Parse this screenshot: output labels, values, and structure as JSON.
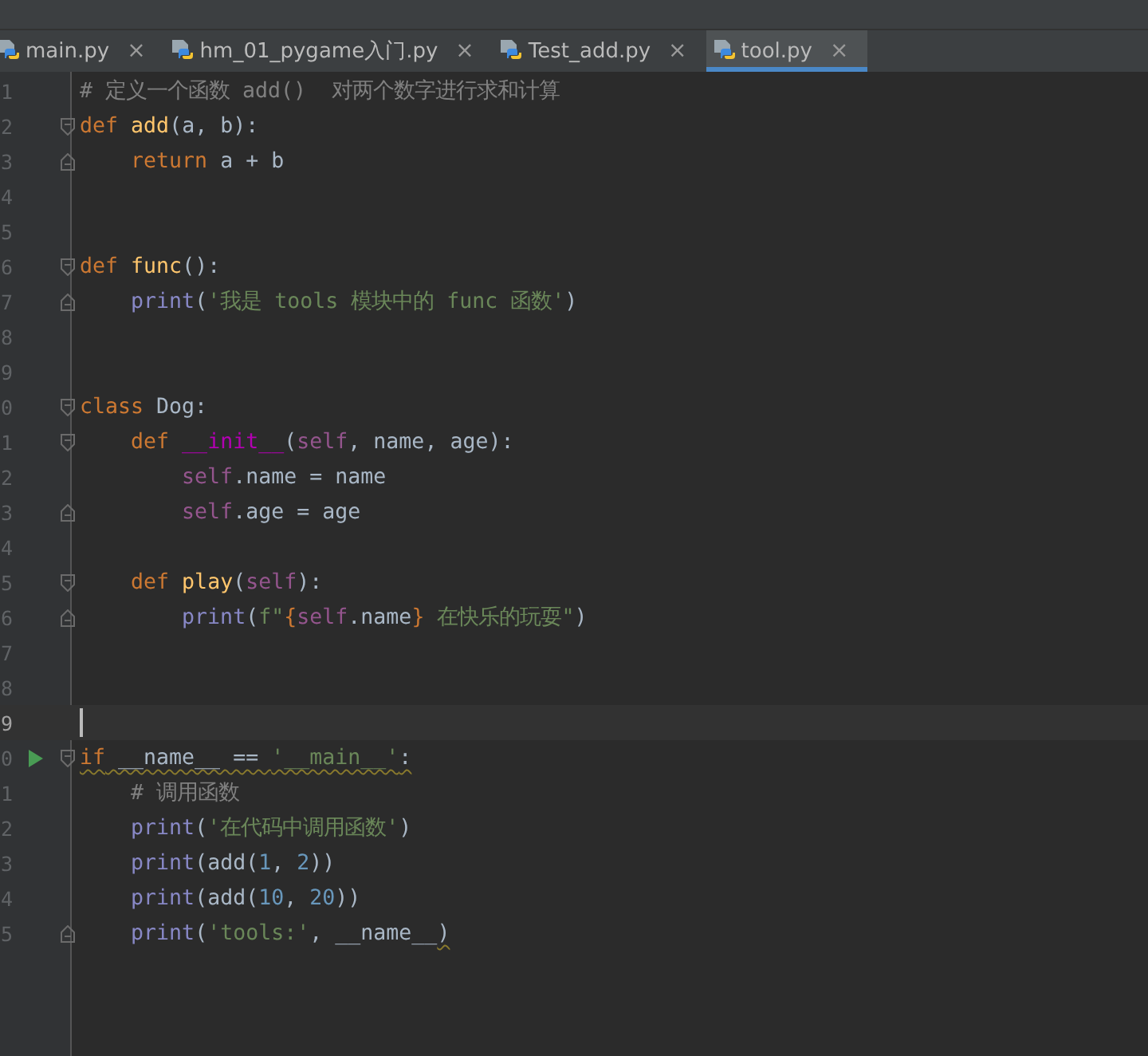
{
  "tabs": [
    {
      "label": "main.py",
      "selected": false,
      "close": "×"
    },
    {
      "label": "hm_01_pygame入门.py",
      "selected": false,
      "close": "×"
    },
    {
      "label": "Test_add.py",
      "selected": false,
      "close": "×"
    },
    {
      "label": "tool.py",
      "selected": true,
      "close": "×"
    }
  ],
  "editor": {
    "lines": [
      {
        "number": "1",
        "fold_start": false,
        "fold_end": false,
        "run": false,
        "current": false,
        "tokens": [
          {
            "kind": "comment",
            "text": "# 定义一个函数 add()  对两个数字进行求和计算"
          }
        ]
      },
      {
        "number": "2",
        "fold_start": true,
        "fold_end": false,
        "run": false,
        "current": false,
        "tokens": [
          {
            "kind": "keyword",
            "text": "def"
          },
          {
            "kind": "function",
            "text": " add"
          },
          {
            "kind": "plain",
            "text": "(a, b):"
          }
        ]
      },
      {
        "number": "3",
        "fold_start": false,
        "fold_end": true,
        "run": false,
        "current": false,
        "tokens": [
          {
            "kind": "keyword",
            "text": "    return"
          },
          {
            "kind": "plain",
            "text": " a + b"
          }
        ]
      },
      {
        "number": "4",
        "fold_start": false,
        "fold_end": false,
        "run": false,
        "current": false
      },
      {
        "number": "5",
        "fold_start": false,
        "fold_end": false,
        "run": false,
        "current": false
      },
      {
        "number": "6",
        "fold_start": true,
        "fold_end": false,
        "run": false,
        "current": false,
        "tokens": [
          {
            "kind": "keyword",
            "text": "def"
          },
          {
            "kind": "function",
            "text": " func"
          },
          {
            "kind": "plain",
            "text": "():"
          }
        ]
      },
      {
        "number": "7",
        "fold_start": false,
        "fold_end": true,
        "run": false,
        "current": false,
        "tokens": [
          {
            "kind": "builtin",
            "text": "    print"
          },
          {
            "kind": "plain",
            "text": "("
          },
          {
            "kind": "string",
            "text": "'我是 tools 模块中的 func 函数'"
          },
          {
            "kind": "plain",
            "text": ")"
          }
        ]
      },
      {
        "number": "8",
        "fold_start": false,
        "fold_end": false,
        "run": false,
        "current": false
      },
      {
        "number": "9",
        "fold_start": false,
        "fold_end": false,
        "run": false,
        "current": false
      },
      {
        "number": "0",
        "fold_start": true,
        "fold_end": false,
        "run": false,
        "current": false,
        "tokens": [
          {
            "kind": "keyword",
            "text": "class"
          },
          {
            "kind": "plain",
            "text": " Dog:"
          }
        ]
      },
      {
        "number": "1",
        "fold_start": true,
        "fold_end": false,
        "run": false,
        "current": false,
        "tokens": [
          {
            "kind": "keyword",
            "text": "    def"
          },
          {
            "kind": "magic",
            "text": " __init__"
          },
          {
            "kind": "plain",
            "text": "("
          },
          {
            "kind": "self",
            "text": "self"
          },
          {
            "kind": "plain",
            "text": ", name, age):"
          }
        ]
      },
      {
        "number": "2",
        "fold_start": false,
        "fold_end": false,
        "run": false,
        "current": false,
        "tokens": [
          {
            "kind": "self",
            "text": "        self"
          },
          {
            "kind": "plain",
            "text": ".name = name"
          }
        ]
      },
      {
        "number": "3",
        "fold_start": false,
        "fold_end": true,
        "run": false,
        "current": false,
        "tokens": [
          {
            "kind": "self",
            "text": "        self"
          },
          {
            "kind": "plain",
            "text": ".age = age"
          }
        ]
      },
      {
        "number": "4",
        "fold_start": false,
        "fold_end": false,
        "run": false,
        "current": false
      },
      {
        "number": "5",
        "fold_start": true,
        "fold_end": false,
        "run": false,
        "current": false,
        "tokens": [
          {
            "kind": "keyword",
            "text": "    def"
          },
          {
            "kind": "function",
            "text": " play"
          },
          {
            "kind": "plain",
            "text": "("
          },
          {
            "kind": "self",
            "text": "self"
          },
          {
            "kind": "plain",
            "text": "):"
          }
        ]
      },
      {
        "number": "6",
        "fold_start": false,
        "fold_end": true,
        "run": false,
        "current": false,
        "tokens": [
          {
            "kind": "builtin",
            "text": "        print"
          },
          {
            "kind": "plain",
            "text": "("
          },
          {
            "kind": "string",
            "text": "f\""
          },
          {
            "kind": "keyword",
            "text": "{"
          },
          {
            "kind": "self",
            "text": "self"
          },
          {
            "kind": "plain",
            "text": ".name"
          },
          {
            "kind": "keyword",
            "text": "}"
          },
          {
            "kind": "string",
            "text": " 在快乐的玩耍\""
          },
          {
            "kind": "plain",
            "text": ")"
          }
        ]
      },
      {
        "number": "7",
        "fold_start": false,
        "fold_end": false,
        "run": false,
        "current": false
      },
      {
        "number": "8",
        "fold_start": false,
        "fold_end": false,
        "run": false,
        "current": false
      },
      {
        "number": "9",
        "fold_start": false,
        "fold_end": false,
        "run": false,
        "current": true
      },
      {
        "number": "0",
        "fold_start": true,
        "fold_end": false,
        "run": true,
        "current": false,
        "tokens": [
          {
            "kind": "keyword",
            "text": "if",
            "warning": true
          },
          {
            "kind": "plain",
            "text": " __name__ == ",
            "warning": true
          },
          {
            "kind": "string",
            "text": "'__main__'",
            "warning": true
          },
          {
            "kind": "plain",
            "text": ":",
            "warning": true
          }
        ]
      },
      {
        "number": "1",
        "fold_start": false,
        "fold_end": false,
        "run": false,
        "current": false,
        "tokens": [
          {
            "kind": "comment",
            "text": "    # 调用函数"
          }
        ]
      },
      {
        "number": "2",
        "fold_start": false,
        "fold_end": false,
        "run": false,
        "current": false,
        "tokens": [
          {
            "kind": "builtin",
            "text": "    print"
          },
          {
            "kind": "plain",
            "text": "("
          },
          {
            "kind": "string",
            "text": "'在代码中调用函数'"
          },
          {
            "kind": "plain",
            "text": ")"
          }
        ]
      },
      {
        "number": "3",
        "fold_start": false,
        "fold_end": false,
        "run": false,
        "current": false,
        "tokens": [
          {
            "kind": "builtin",
            "text": "    print"
          },
          {
            "kind": "plain",
            "text": "(add("
          },
          {
            "kind": "number",
            "text": "1"
          },
          {
            "kind": "plain",
            "text": ", "
          },
          {
            "kind": "number",
            "text": "2"
          },
          {
            "kind": "plain",
            "text": "))"
          }
        ]
      },
      {
        "number": "4",
        "fold_start": false,
        "fold_end": false,
        "run": false,
        "current": false,
        "tokens": [
          {
            "kind": "builtin",
            "text": "    print"
          },
          {
            "kind": "plain",
            "text": "(add("
          },
          {
            "kind": "number",
            "text": "10"
          },
          {
            "kind": "plain",
            "text": ", "
          },
          {
            "kind": "number",
            "text": "20"
          },
          {
            "kind": "plain",
            "text": "))"
          }
        ]
      },
      {
        "number": "5",
        "fold_start": false,
        "fold_end": true,
        "run": false,
        "current": false,
        "tokens": [
          {
            "kind": "builtin",
            "text": "    print"
          },
          {
            "kind": "plain",
            "text": "("
          },
          {
            "kind": "string",
            "text": "'tools:'"
          },
          {
            "kind": "plain",
            "text": ", __name__"
          },
          {
            "kind": "plain",
            "text": ")",
            "warning": true
          }
        ]
      }
    ]
  }
}
